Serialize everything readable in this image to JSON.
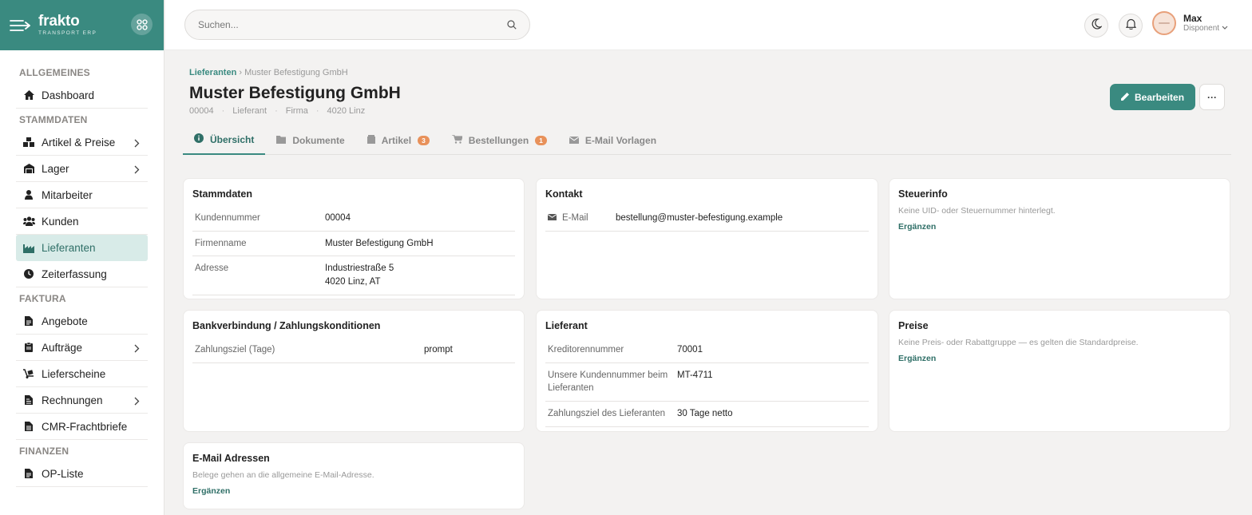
{
  "brand": {
    "name": "frakto",
    "subtitle": "TRANSPORT ERP"
  },
  "sidebar": {
    "sections": [
      {
        "title": "ALLGEMEINES",
        "items": [
          {
            "label": "Dashboard",
            "icon": "home-icon"
          }
        ]
      },
      {
        "title": "STAMMDATEN",
        "items": [
          {
            "label": "Artikel & Preise",
            "icon": "boxes-icon",
            "has_children": true
          },
          {
            "label": "Lager",
            "icon": "warehouse-icon",
            "has_children": true
          },
          {
            "label": "Mitarbeiter",
            "icon": "person-icon"
          },
          {
            "label": "Kunden",
            "icon": "users-icon"
          },
          {
            "label": "Lieferanten",
            "icon": "industry-icon",
            "active": true
          },
          {
            "label": "Zeiterfassung",
            "icon": "clock-icon"
          }
        ]
      },
      {
        "title": "FAKTURA",
        "items": [
          {
            "label": "Angebote",
            "icon": "file-icon"
          },
          {
            "label": "Aufträge",
            "icon": "clipboard-icon",
            "has_children": true
          },
          {
            "label": "Lieferscheine",
            "icon": "dolly-icon"
          },
          {
            "label": "Rechnungen",
            "icon": "invoice-icon",
            "has_children": true
          },
          {
            "label": "CMR-Frachtbriefe",
            "icon": "document-icon"
          }
        ]
      },
      {
        "title": "FINANZEN",
        "items": [
          {
            "label": "OP-Liste",
            "icon": "file-icon"
          }
        ]
      }
    ]
  },
  "search": {
    "placeholder": "Suchen..."
  },
  "user": {
    "name": "Max",
    "role": "Disponent"
  },
  "breadcrumb": {
    "parent": "Lieferanten",
    "separator": "›",
    "current": "Muster Befestigung GmbH"
  },
  "page": {
    "title": "Muster Befestigung GmbH",
    "meta": [
      "00004",
      "Lieferant",
      "Firma",
      "4020 Linz"
    ],
    "meta_separator": "·",
    "edit_label": "Bearbeiten",
    "more_label": "···"
  },
  "tabs": [
    {
      "label": "Übersicht",
      "icon": "info-icon",
      "active": true
    },
    {
      "label": "Dokumente",
      "icon": "folder-icon"
    },
    {
      "label": "Artikel",
      "icon": "box-icon",
      "badge": "3"
    },
    {
      "label": "Bestellungen",
      "icon": "cart-icon",
      "badge": "1"
    },
    {
      "label": "E-Mail Vorlagen",
      "icon": "envelope-icon"
    }
  ],
  "cards": {
    "stammdaten": {
      "title": "Stammdaten",
      "rows": [
        {
          "key": "Kundennummer",
          "value": "00004"
        },
        {
          "key": "Firmenname",
          "value": "Muster Befestigung GmbH"
        },
        {
          "key": "Adresse",
          "value_line1": "Industriestraße 5",
          "value_line2": "4020 Linz, AT"
        }
      ]
    },
    "kontakt": {
      "title": "Kontakt",
      "email_label": "E-Mail",
      "email": "bestellung@muster-befestigung.example"
    },
    "steuerinfo": {
      "title": "Steuerinfo",
      "text": "Keine UID- oder Steuernummer hinterlegt.",
      "action": "Ergänzen"
    },
    "bank": {
      "title": "Bankverbindung / Zahlungskonditionen",
      "rows": [
        {
          "key": "Zahlungsziel (Tage)",
          "value": "prompt"
        }
      ]
    },
    "lieferant": {
      "title": "Lieferant",
      "rows": [
        {
          "key": "Kreditorennummer",
          "value": "70001"
        },
        {
          "key_line1": "Unsere Kundennummer beim",
          "key_line2": "Lieferanten",
          "value": "MT-4711"
        },
        {
          "key": "Zahlungsziel des Lieferanten",
          "value": "30 Tage netto"
        }
      ]
    },
    "preise": {
      "title": "Preise",
      "text": "Keine Preis- oder Rabattgruppe — es gelten die Standardpreise.",
      "action": "Ergänzen"
    },
    "email_adressen": {
      "title": "E-Mail Adressen",
      "text": "Belege gehen an die allgemeine E-Mail-Adresse.",
      "action": "Ergänzen"
    }
  },
  "colors": {
    "primary": "#3a8a80",
    "accent_badge": "#e8915a",
    "active_bg": "#d8ebe8"
  }
}
